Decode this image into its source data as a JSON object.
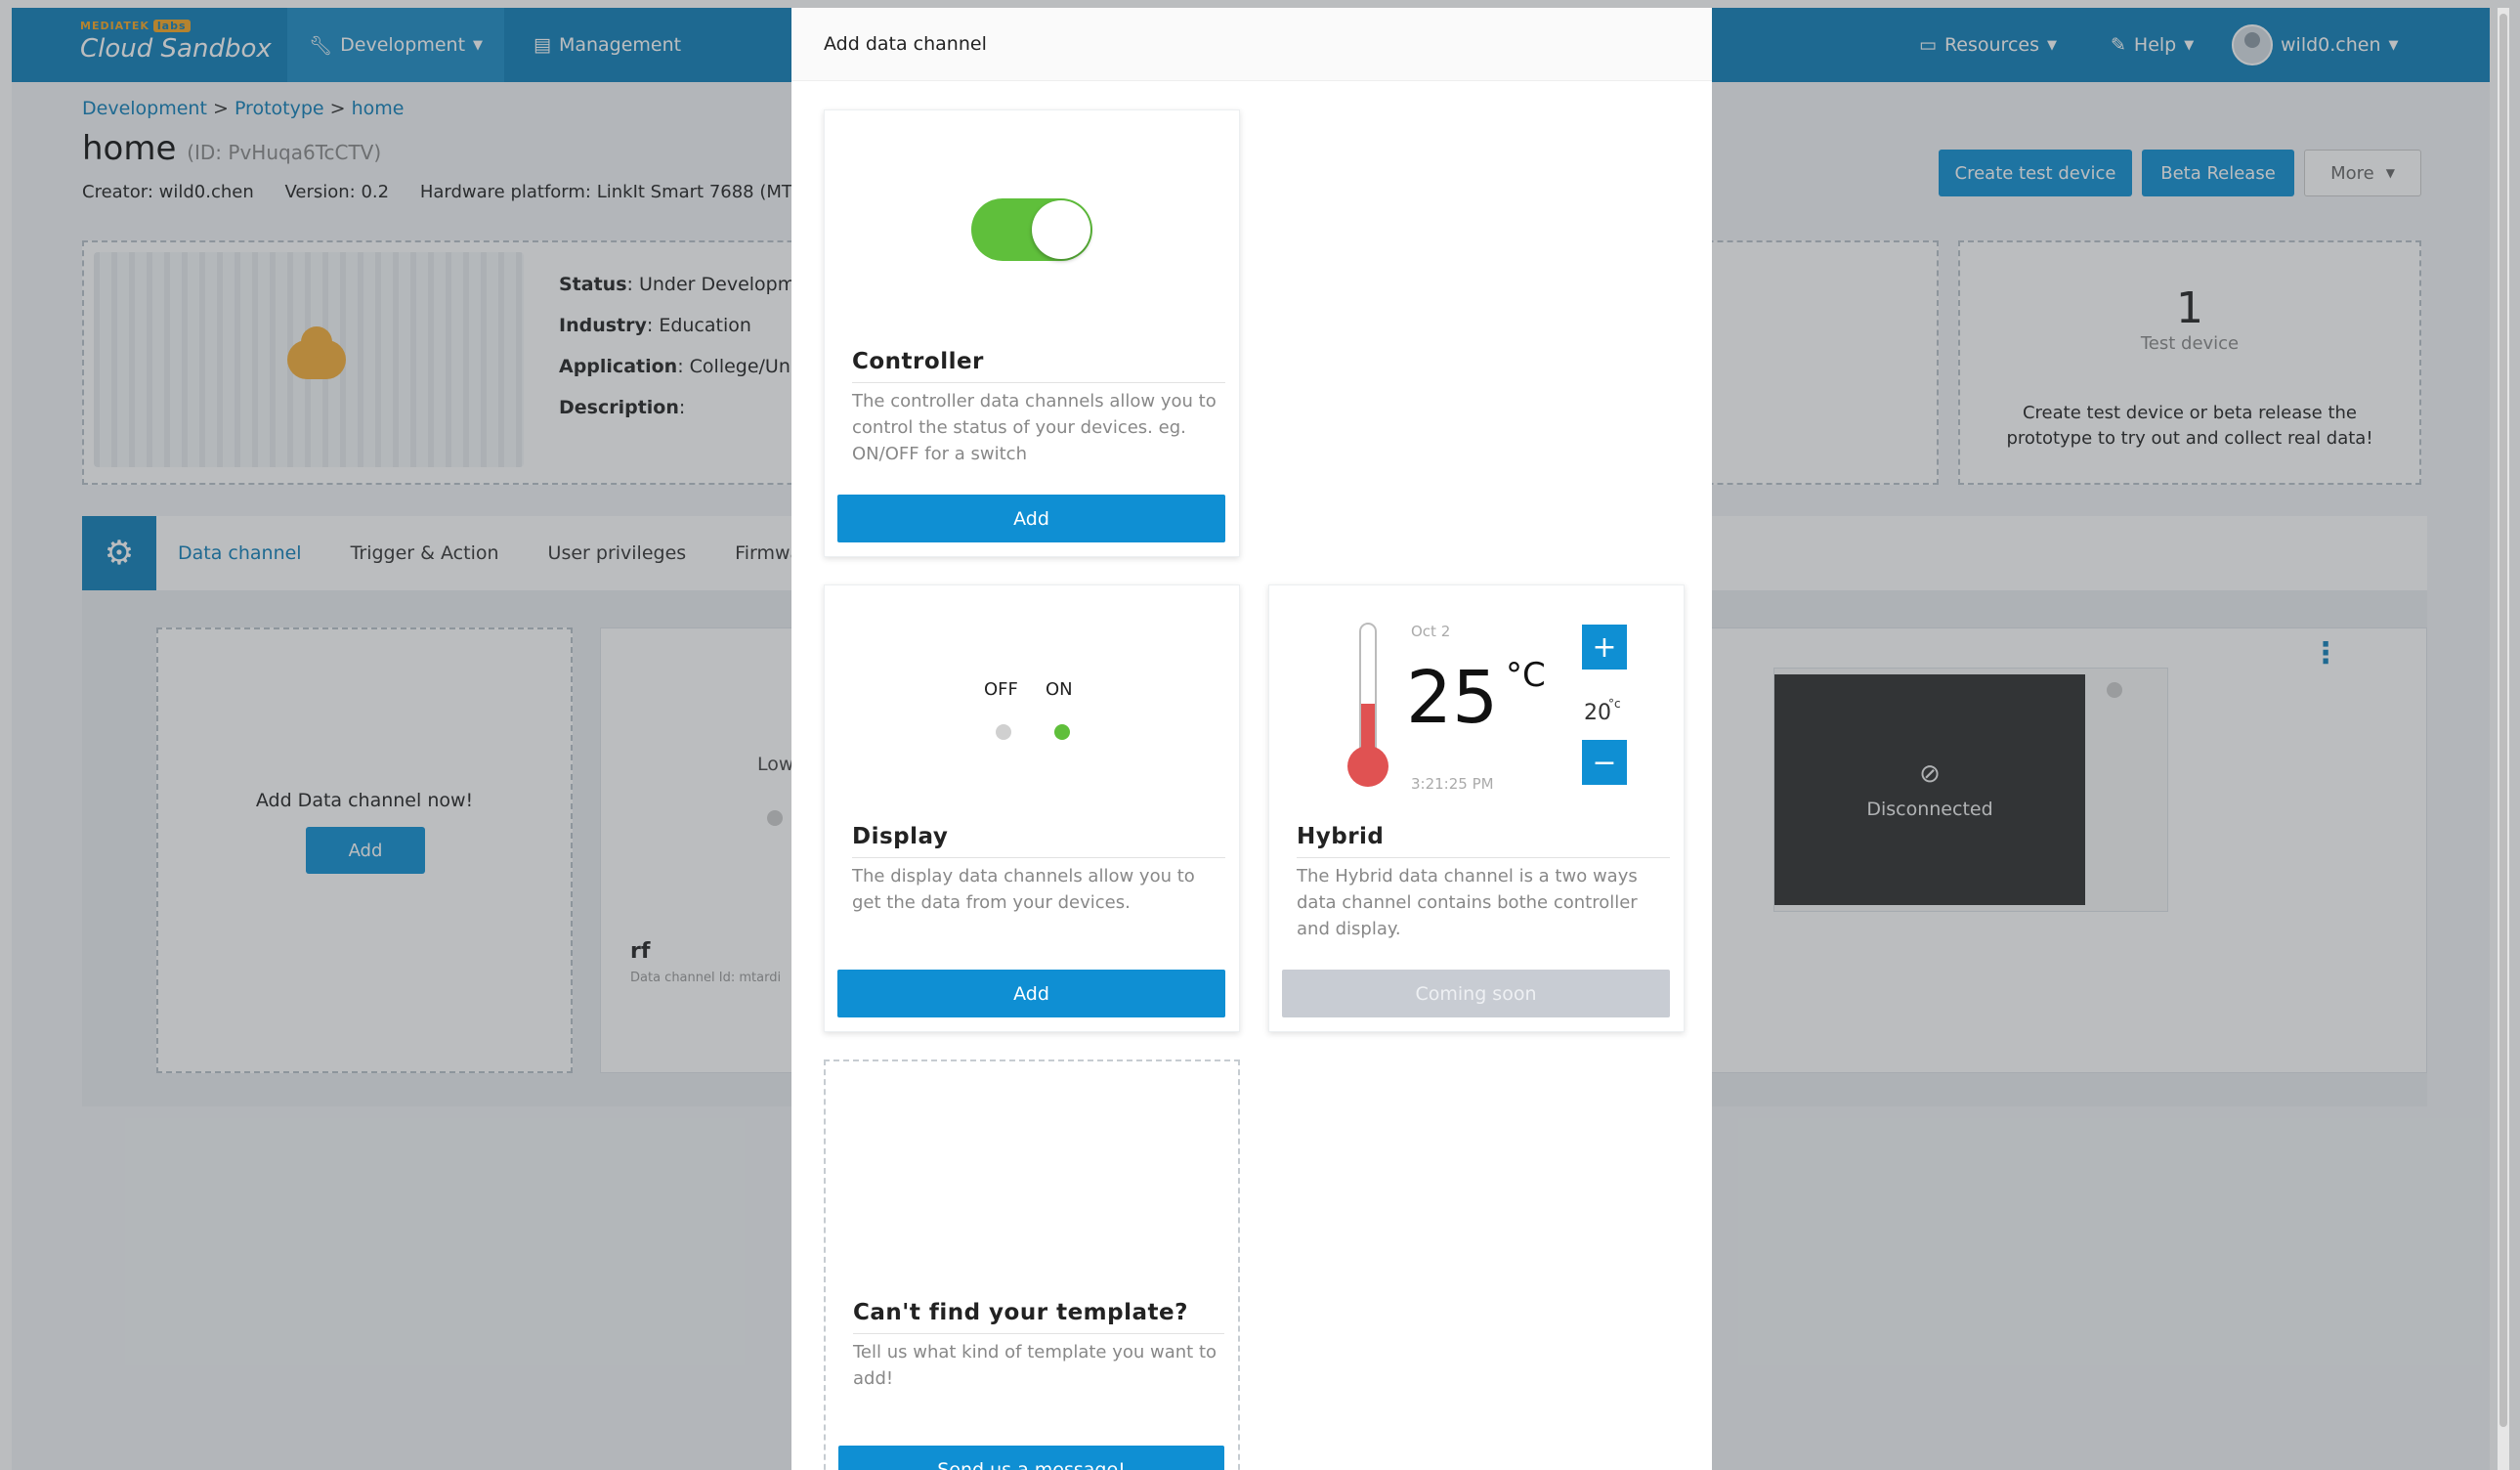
{
  "topnav": {
    "brand_top": "MEDIATEK",
    "brand_labs": "labs",
    "brand_name": "Cloud Sandbox",
    "development": "Development",
    "management": "Management",
    "resources": "Resources",
    "help": "Help",
    "user": "wild0.chen"
  },
  "breadcrumb": {
    "development": "Development",
    "prototype": "Prototype",
    "home": "home",
    "separator": ">"
  },
  "prototype": {
    "title": "home",
    "id": "(ID: PvHuqa6TcCTV)",
    "creator": "Creator: wild0.chen",
    "version": "Version: 0.2",
    "platform": "Hardware platform: LinkIt Smart 7688 (MT"
  },
  "actions": {
    "create_test_device": "Create test device",
    "beta_release": "Beta Release",
    "more": "More"
  },
  "info": {
    "status_label": "Status",
    "status_value": ": Under Developme",
    "industry_label": "Industry",
    "industry_value": ": Education",
    "application_label": "Application",
    "application_value": ": College/Uni",
    "description_label": "Description",
    "description_value": ":"
  },
  "stats": {
    "test_device_count": "1",
    "test_device_label": "Test device",
    "hint_line1": "Create test device or beta release the",
    "hint_line2": "prototype to try out and collect real data!"
  },
  "tabs": [
    "Data channel",
    "Trigger & Action",
    "User privileges",
    "Firmwar"
  ],
  "data_channels": {
    "add_prompt": "Add Data channel now!",
    "add_button": "Add",
    "partial_label": "Low",
    "channel_name": "rf",
    "channel_id": "Data channel Id: mtardi",
    "disconnected": "Disconnected"
  },
  "modal": {
    "title": "Add data channel",
    "controller": {
      "title": "Controller",
      "description": "The controller data channels allow you to control the status of your devices. eg. ON/OFF for a switch",
      "button": "Add"
    },
    "display": {
      "off_label": "OFF",
      "on_label": "ON",
      "title": "Display",
      "description": "The display data channels allow you to get the data from your devices.",
      "button": "Add"
    },
    "hybrid": {
      "date": "Oct 2",
      "temperature": "25",
      "unit": "°C",
      "setpoint": "20",
      "setpoint_unit": "°c",
      "time": "3:21:25 PM",
      "plus": "+",
      "minus": "−",
      "title": "Hybrid",
      "description": "The Hybrid data channel is a two ways data channel contains bothe controller and display.",
      "button": "Coming soon"
    },
    "custom": {
      "title": "Can't find your template?",
      "description": "Tell us what kind of template you want to add!",
      "button": "Send us a message!"
    }
  },
  "colors": {
    "brand_blue": "#0f7fb8",
    "button_blue": "#0f8fd3",
    "toggle_green": "#5fbf3b",
    "thermo_red": "#e05252"
  }
}
